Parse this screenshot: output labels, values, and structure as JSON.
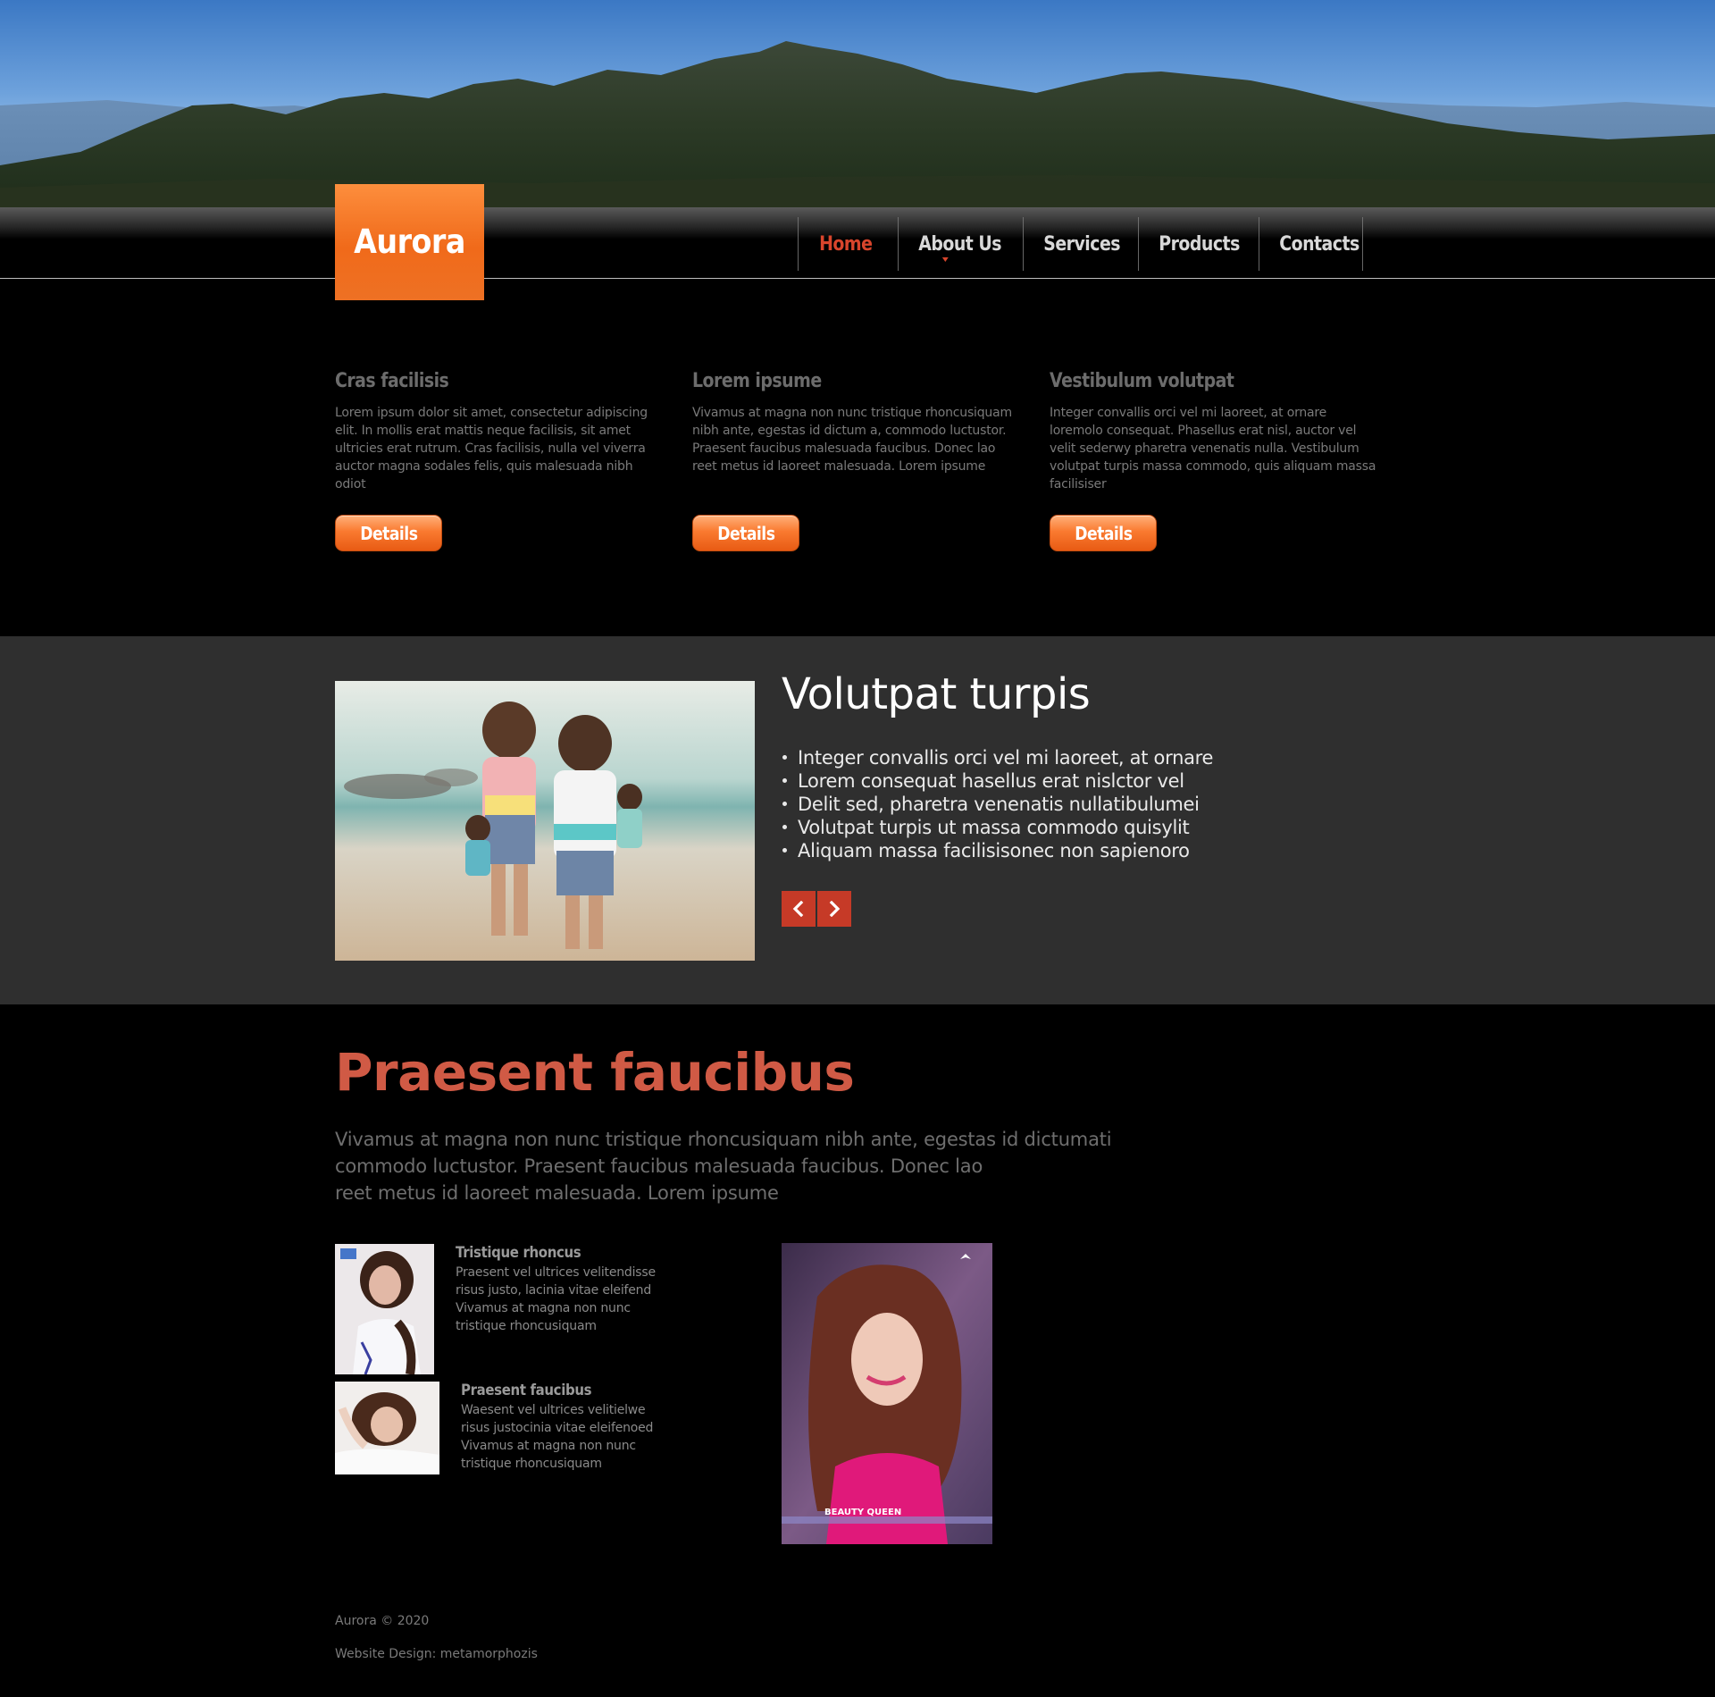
{
  "brand": {
    "name": "Aurora"
  },
  "nav": {
    "items": [
      {
        "label": "Home",
        "active": true
      },
      {
        "label": "About Us",
        "active": false,
        "has_dropdown": true
      },
      {
        "label": "Services",
        "active": false
      },
      {
        "label": "Products",
        "active": false
      },
      {
        "label": "Contacts",
        "active": false
      }
    ]
  },
  "features": [
    {
      "title": "Cras facilisis",
      "text": "Lorem ipsum dolor sit amet, consectetur adipiscing elit. In mollis erat mattis neque facilisis, sit amet ultricies erat rutrum. Cras facilisis, nulla vel viverra auctor magna sodales felis, quis malesuada nibh odiot",
      "button": "Details"
    },
    {
      "title": "Lorem ipsume",
      "text": "Vivamus at magna non nunc tristique rhoncusiquam nibh ante, egestas id dictum a, commodo luctustor. Praesent faucibus malesuada faucibus. Donec lao reet metus id laoreet malesuada. Lorem ipsume",
      "button": "Details"
    },
    {
      "title": "Vestibulum volutpat",
      "text": "Integer convallis orci vel mi laoreet, at ornare loremolo consequat. Phasellus erat nisl, auctor vel velit sederwy pharetra venenatis nulla. Vestibulum volutpat turpis massa commodo, quis aliquam massa facilisiser",
      "button": "Details"
    }
  ],
  "slider": {
    "title": "Volutpat turpis",
    "bullets": [
      "Integer convallis orci vel mi laoreet, at ornare",
      "Lorem consequat hasellus erat nislctor vel",
      "Delit sed, pharetra venenatis nullatibulumei",
      "Volutpat turpis ut massa commodo quisylit",
      "Aliquam massa facilisisonec non sapienoro"
    ],
    "prev_icon": "chevron-left-icon",
    "next_icon": "chevron-right-icon"
  },
  "section": {
    "title": "Praesent faucibus",
    "intro_lines": [
      "Vivamus at magna non nunc tristique rhoncusiquam nibh ante, egestas id dictumati",
      "commodo luctustor. Praesent faucibus malesuada faucibus. Donec lao",
      "reet metus id laoreet malesuada. Lorem ipsume"
    ],
    "items": [
      {
        "title": "Tristique rhoncus",
        "text": "Praesent vel ultrices velitendisse risus justo, lacinia vitae eleifend Vivamus at magna non nunc tristique rhoncusiquam"
      },
      {
        "title": "Praesent faucibus",
        "text": "Waesent vel ultrices velitielwe risus justocinia vitae eleifenoed Vivamus at magna non nunc tristique rhoncusiquam"
      }
    ],
    "poster_caption": "BEAUTY QUEEN"
  },
  "footer": {
    "copyright": "Aurora © 2020",
    "credit": "Website Design: metamorphozis"
  },
  "colors": {
    "accent_orange": "#f06a1a",
    "accent_red": "#d05a45",
    "band_bg": "#2f2f2f",
    "page_bg": "#000000"
  }
}
